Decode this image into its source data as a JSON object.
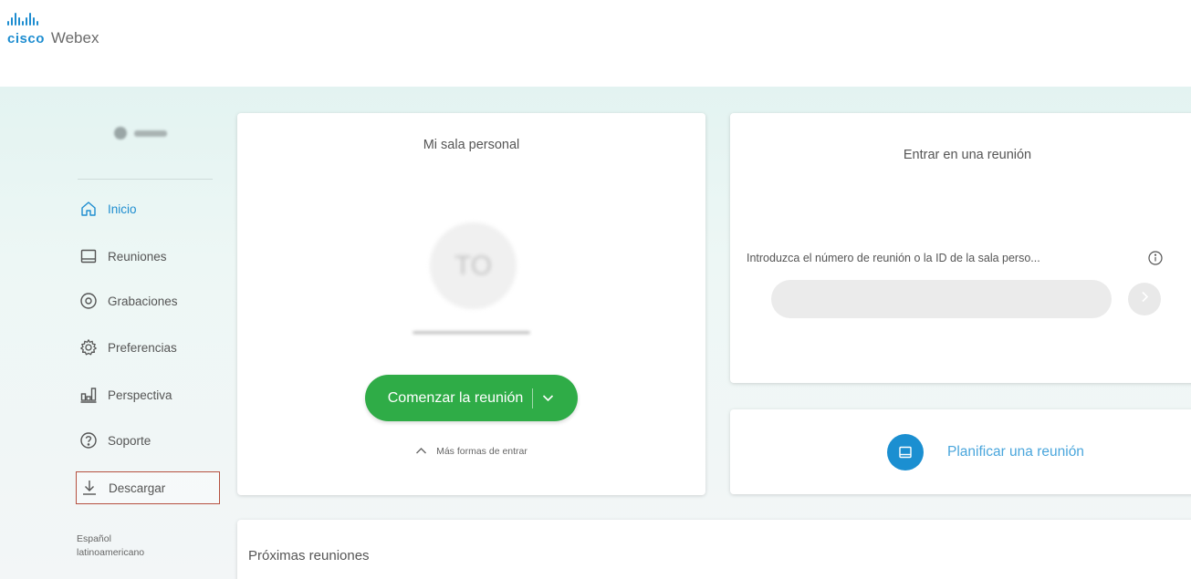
{
  "brand": {
    "cisco": "cisco",
    "product": "Webex",
    "accent": "#1e8dd0"
  },
  "sidebar": {
    "items": [
      {
        "label": "Inicio",
        "icon": "home-icon",
        "active": true
      },
      {
        "label": "Reuniones",
        "icon": "calendar-icon"
      },
      {
        "label": "Grabaciones",
        "icon": "recordings-icon"
      },
      {
        "label": "Preferencias",
        "icon": "gear-icon"
      },
      {
        "label": "Perspectiva",
        "icon": "insights-icon"
      },
      {
        "label": "Soporte",
        "icon": "help-icon"
      },
      {
        "label": "Descargar",
        "icon": "download-icon",
        "highlighted": true
      }
    ],
    "language_line1": "Español",
    "language_line2": "latinoamericano"
  },
  "personal_room": {
    "title": "Mi sala personal",
    "initials": "TO",
    "start_button_label": "Comenzar la reunión",
    "start_button_color": "#2fac47",
    "more_ways_label": "Más formas de entrar"
  },
  "join": {
    "title": "Entrar en una reunión",
    "input_label": "Introduzca el número de reunión o la ID de la sala perso...",
    "input_value": ""
  },
  "plan": {
    "label": "Planificar una reunión",
    "icon_color": "#1b8fd1"
  },
  "upcoming": {
    "title": "Próximas reuniones"
  }
}
